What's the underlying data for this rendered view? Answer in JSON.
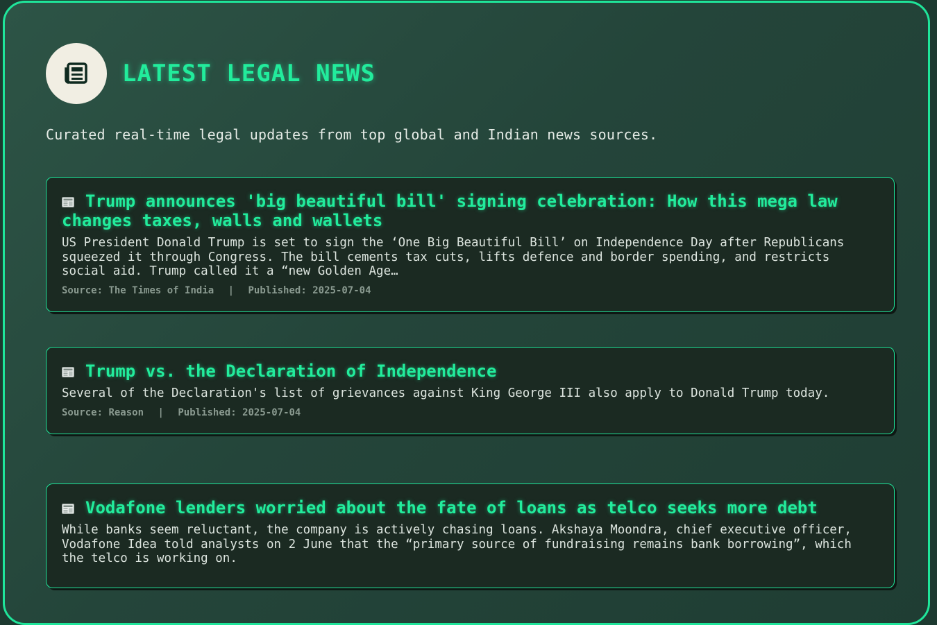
{
  "header": {
    "title": "LATEST LEGAL NEWS",
    "subtitle": "Curated real-time legal updates from top global and Indian news sources.",
    "icon": "newspaper-icon"
  },
  "colors": {
    "accent": "#22ec9c",
    "card_bg": "#1b2a22",
    "badge_bg": "#f1eee3"
  },
  "labels": {
    "source": "Source:",
    "published": "Published:",
    "separator": "|"
  },
  "articles": [
    {
      "title": "Trump announces 'big beautiful bill' signing celebration: How this mega law changes taxes, walls and wallets",
      "description": "US President Donald Trump is set to sign the ‘One Big Beautiful Bill’ on Independence Day after Republicans squeezed it through Congress. The bill cements tax cuts, lifts defence and border spending, and restricts social aid. Trump called it a “new Golden Age…",
      "source": "The Times of India",
      "published": "2025-07-04"
    },
    {
      "title": "Trump vs. the Declaration of Independence",
      "description": "Several of the Declaration's list of grievances against King George III also apply to Donald Trump today.",
      "source": "Reason",
      "published": "2025-07-04"
    },
    {
      "title": "Vodafone lenders worried about the fate of loans as telco seeks more debt",
      "description": "While banks seem reluctant, the company is actively chasing loans. Akshaya Moondra, chief executive officer, Vodafone Idea told analysts on 2 June that the “primary source of fundraising remains bank borrowing”, which the telco is working on.",
      "source": "",
      "published": ""
    }
  ]
}
